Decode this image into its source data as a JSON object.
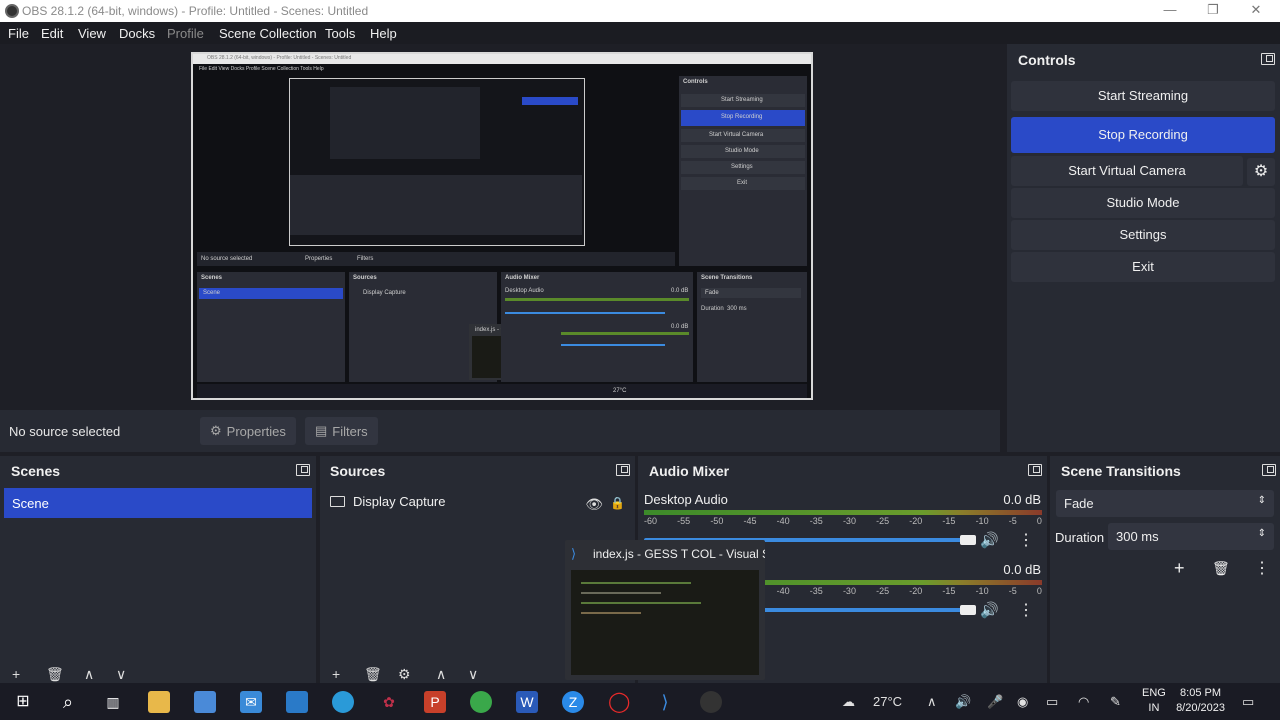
{
  "window": {
    "title": "OBS 28.1.2 (64-bit, windows) - Profile: Untitled - Scenes: Untitled",
    "minimize": "—",
    "maximize": "❐",
    "close": "✕"
  },
  "menu": [
    "File",
    "Edit",
    "View",
    "Docks",
    "Profile",
    "Scene Collection",
    "Tools",
    "Help"
  ],
  "source_bar": {
    "no_source": "No source selected",
    "properties": "Properties",
    "filters": "Filters"
  },
  "controls": {
    "title": "Controls",
    "buttons": [
      "Start Streaming",
      "Stop Recording",
      "Start Virtual Camera",
      "Studio Mode",
      "Settings",
      "Exit"
    ],
    "active_color": "#2a4ac8"
  },
  "scenes": {
    "title": "Scenes",
    "items": [
      "Scene"
    ]
  },
  "sources": {
    "title": "Sources",
    "items": [
      "Display Capture"
    ]
  },
  "audio_mixer": {
    "title": "Audio Mixer",
    "channels": [
      {
        "name": "Desktop Audio",
        "level": "0.0 dB"
      },
      {
        "name": "",
        "level": "0.0 dB"
      }
    ],
    "ticks": [
      "-60",
      "-55",
      "-50",
      "-45",
      "-40",
      "-35",
      "-30",
      "-25",
      "-20",
      "-15",
      "-10",
      "-5",
      "0"
    ]
  },
  "transitions": {
    "title": "Scene Transitions",
    "selected": "Fade",
    "duration_label": "Duration",
    "duration_value": "300 ms"
  },
  "taskbar_popup": {
    "title": "index.js - GESS T COL - Visual S..."
  },
  "taskbar": {
    "weather": "27°C",
    "lang_line1": "ENG",
    "lang_line2": "IN",
    "time": "8:05 PM",
    "date": "8/20/2023"
  },
  "preview_mini": {
    "title": "OBS 28.1.2 (64-bit, windows) - Profile: Untitled - Scenes: Untitled",
    "menu": "File  Edit  View  Docks  Profile  Scene Collection  Tools  Help",
    "controls": "Controls",
    "buttons": [
      "Start Streaming",
      "Stop Recording",
      "Start Virtual Camera",
      "Studio Mode",
      "Settings",
      "Exit"
    ],
    "no_source": "No source selected",
    "properties": "Properties",
    "filters": "Filters",
    "scenes": "Scenes",
    "scene": "Scene",
    "sources": "Sources",
    "display_capture": "Display Capture",
    "audio_mixer": "Audio Mixer",
    "desktop_audio": "Desktop Audio",
    "level": "0.0 dB",
    "popup": "index.js - GESS T COL - Visual S...",
    "scene_transitions": "Scene Transitions",
    "fade": "Fade",
    "duration": "Duration",
    "duration_value": "300 ms",
    "weather": "27°C"
  }
}
